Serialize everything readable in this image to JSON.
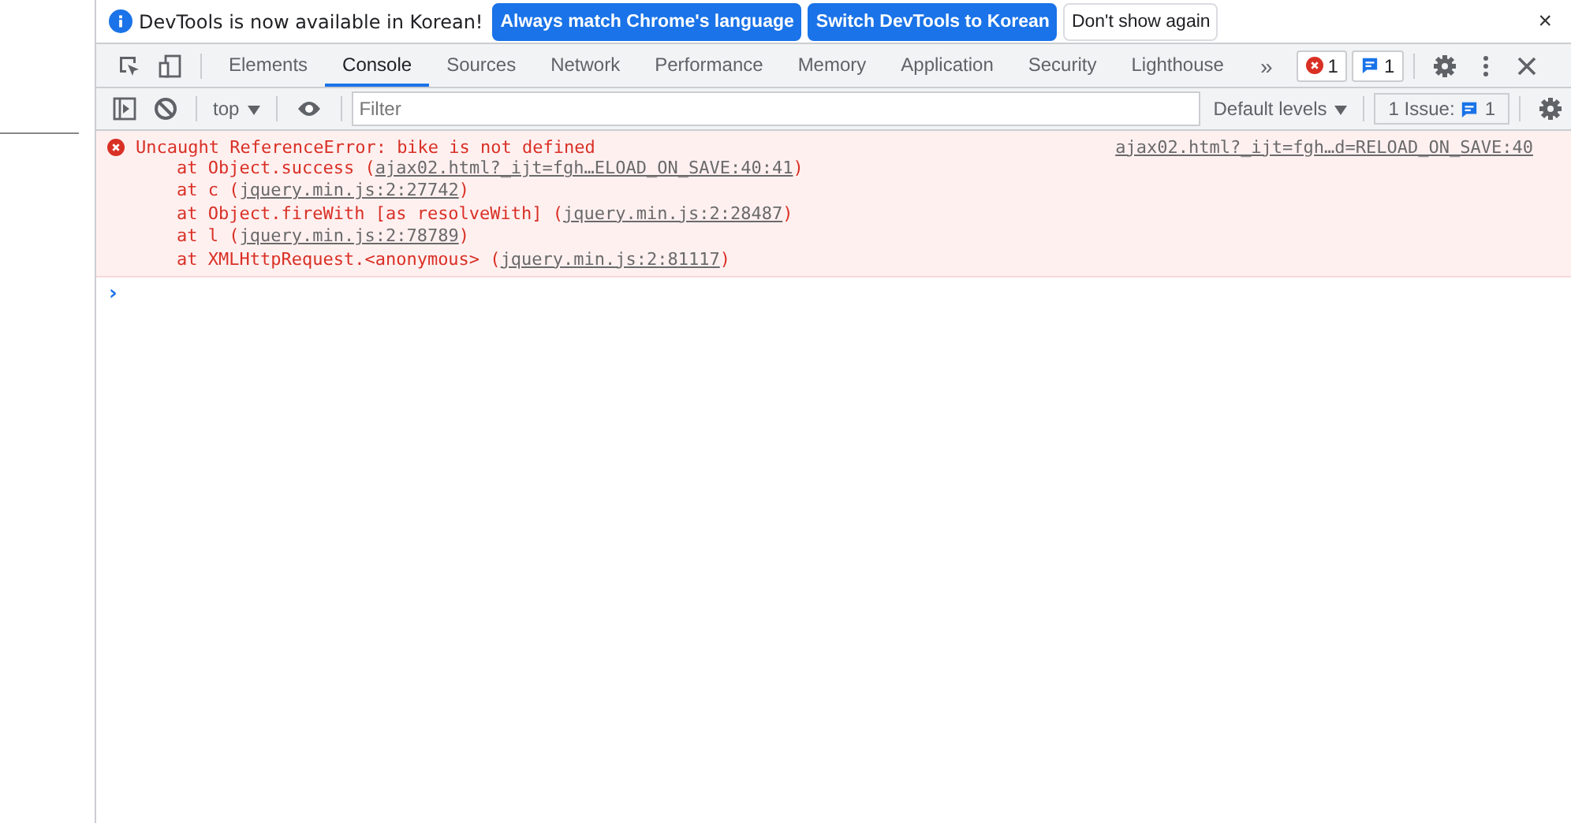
{
  "infobar": {
    "message": "DevTools is now available in Korean!",
    "buttons": [
      {
        "label": "Always match Chrome's language",
        "kind": "primary"
      },
      {
        "label": "Switch DevTools to Korean",
        "kind": "primary"
      },
      {
        "label": "Don't show again",
        "kind": "secondary"
      }
    ],
    "close": "×"
  },
  "tabs": [
    {
      "label": "Elements",
      "selected": false
    },
    {
      "label": "Console",
      "selected": true
    },
    {
      "label": "Sources",
      "selected": false
    },
    {
      "label": "Network",
      "selected": false
    },
    {
      "label": "Performance",
      "selected": false
    },
    {
      "label": "Memory",
      "selected": false
    },
    {
      "label": "Application",
      "selected": false
    },
    {
      "label": "Security",
      "selected": false
    },
    {
      "label": "Lighthouse",
      "selected": false
    }
  ],
  "more_tabs": "»",
  "error_count": "1",
  "message_count": "1",
  "console_toolbar": {
    "context": "top",
    "filter_placeholder": "Filter",
    "levels": "Default levels",
    "issues_label": "1 Issue:",
    "issues_count": "1"
  },
  "error": {
    "message": "Uncaught ReferenceError: bike is not defined",
    "source": "ajax02.html?_ijt=fgh…d=RELOAD_ON_SAVE:40",
    "stack": [
      {
        "text": "at Object.success (",
        "link": "ajax02.html?_ijt=fgh…ELOAD_ON_SAVE:40:41",
        "end": ")"
      },
      {
        "text": "at c (",
        "link": "jquery.min.js:2:27742",
        "end": ")"
      },
      {
        "text": "at Object.fireWith [as resolveWith] (",
        "link": "jquery.min.js:2:28487",
        "end": ")"
      },
      {
        "text": "at l (",
        "link": "jquery.min.js:2:78789",
        "end": ")"
      },
      {
        "text": "at XMLHttpRequest.<anonymous> (",
        "link": "jquery.min.js:2:81117",
        "end": ")"
      }
    ]
  },
  "prompt": "›"
}
